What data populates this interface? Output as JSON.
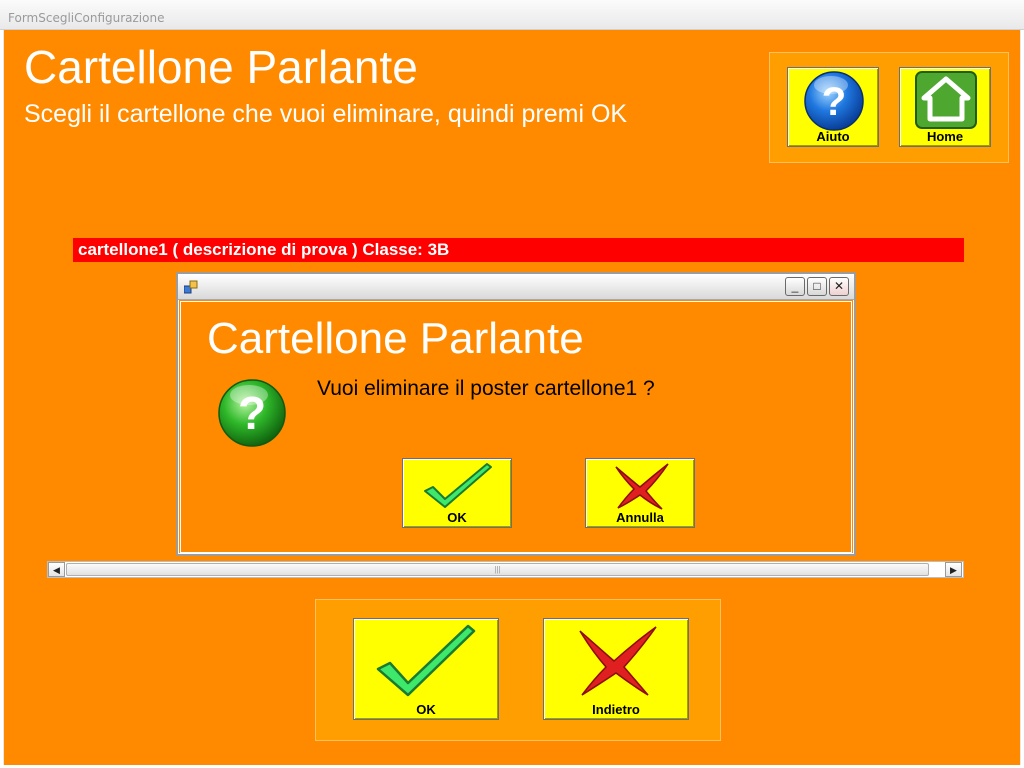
{
  "window": {
    "title": "FormScegliConfigurazione"
  },
  "header": {
    "title": "Cartellone Parlante",
    "subtitle": "Scegli il cartellone che vuoi eliminare, quindi premi OK"
  },
  "top_buttons": {
    "help_label": "Aiuto",
    "home_label": "Home"
  },
  "list": {
    "items": [
      {
        "label": "cartellone1 ( descrizione di prova )  Classe: 3B"
      }
    ]
  },
  "dialog": {
    "title": "Cartellone Parlante",
    "message": "Vuoi eliminare il poster cartellone1 ?",
    "ok_label": "OK",
    "cancel_label": "Annulla",
    "window_buttons": {
      "minimize": "_",
      "maximize": "□",
      "close": "✕"
    }
  },
  "scrollbar": {
    "left_arrow": "◀",
    "right_arrow": "▶",
    "grip": "|||"
  },
  "bottom_buttons": {
    "ok_label": "OK",
    "back_label": "Indietro"
  },
  "icons": {
    "help": "question-mark-circle-icon",
    "home": "house-icon",
    "check": "checkmark-icon",
    "cross": "cross-icon",
    "dialog_question": "question-mark-circle-icon"
  },
  "colors": {
    "background": "#ff8a00",
    "panel": "#ff9e00",
    "button": "#ffff00",
    "selection": "#ff0000"
  }
}
